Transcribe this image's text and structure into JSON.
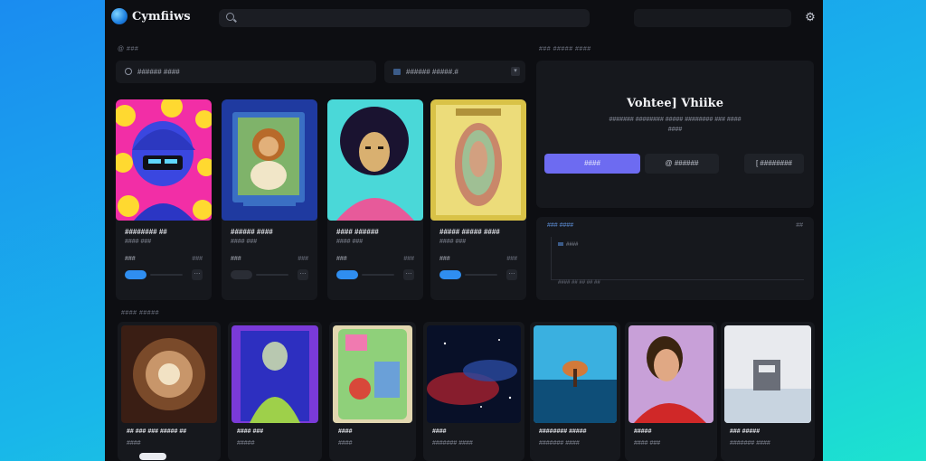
{
  "app": {
    "name": "Cymfiiws"
  },
  "header": {
    "search_placeholder": "",
    "settings_icon": "gear-icon"
  },
  "sections": {
    "featured_label": "@ ###",
    "hero_label": "### ##### ####",
    "more_label": "#### #####"
  },
  "filters": {
    "search_text": "###### ####",
    "sort_text": "###### #####.#"
  },
  "featured_cards": [
    {
      "title": "######## ##",
      "sub": "#### ###",
      "left": "###",
      "right": "###"
    },
    {
      "title": "###### ####",
      "sub": "#### ###",
      "left": "###",
      "right": "###"
    },
    {
      "title": "#### ######",
      "sub": "#### ###",
      "left": "###",
      "right": "###"
    },
    {
      "title": "##### ##### ####",
      "sub": "#### ###",
      "left": "###",
      "right": "###"
    }
  ],
  "hero": {
    "heading": "Vohtee] Vhiike",
    "desc_line1": "####### ######## ##### ######## ### ####",
    "desc_line2": "####",
    "primary_label": "####",
    "secondary_label": "@ ######",
    "tertiary_label": "[ ########"
  },
  "stats": {
    "title": "### ####",
    "close": "##",
    "legend": "####",
    "caption": "#### ## ## ## ##"
  },
  "more_cards": [
    {
      "title": "## ### ### ##### ##",
      "sub": "####"
    },
    {
      "title": "#### ###",
      "sub": "#####"
    },
    {
      "title": "####",
      "sub": "####"
    },
    {
      "title": "####",
      "sub": "####### ####"
    },
    {
      "title": "######## #####",
      "sub": "####### ####"
    },
    {
      "title": "#####",
      "sub": "#### ###"
    },
    {
      "title": "### #####",
      "sub": "####### ####"
    }
  ]
}
